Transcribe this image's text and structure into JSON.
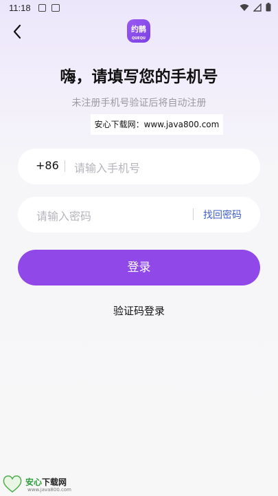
{
  "status_bar": {
    "time": "11:18"
  },
  "app": {
    "logo_text": "约鹊",
    "logo_sub": "QUEQU"
  },
  "header": {
    "title": "嗨，请填写您的手机号",
    "subtitle": "未注册手机号验证后将自动注册"
  },
  "watermark": {
    "text": "安心下载网：www.java800.com"
  },
  "form": {
    "phone": {
      "prefix": "+86",
      "placeholder": "请输入手机号"
    },
    "password": {
      "placeholder": "请输入密码",
      "forgot_label": "找回密码"
    },
    "login_label": "登录",
    "code_login_label": "验证码登录"
  },
  "footer_brand": {
    "heart_text": "安心 软件",
    "name_green": "安心",
    "name_dark": "下载网",
    "url": "www.java800.com"
  },
  "colors": {
    "accent": "#9048e8",
    "link": "#3d5ec8"
  },
  "icons": [
    "back-arrow-icon",
    "wifi-icon",
    "signal-icon",
    "battery-icon"
  ]
}
